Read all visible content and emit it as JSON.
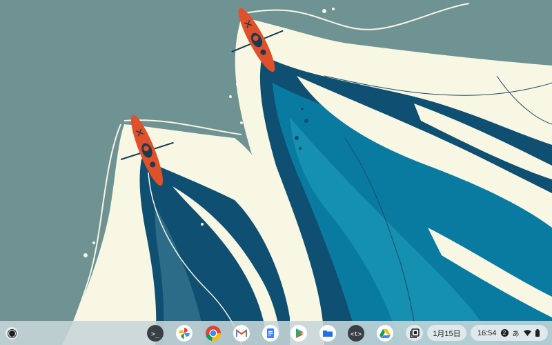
{
  "desktop": {
    "wallpaper": "kayak-river-illustration",
    "colors": {
      "background": "#6f9292",
      "cream": "#f7f7e4",
      "water_dark": "#0f4f72",
      "water_mid": "#0a7ba0",
      "water_light": "#1590b0",
      "kayak": "#e0502a"
    }
  },
  "shelf": {
    "launcher_icon": "launcher-circle-icon",
    "apps": [
      {
        "name": "Terminal",
        "icon": "terminal-icon",
        "glyph": ">_"
      },
      {
        "name": "Photos",
        "icon": "google-photos-icon"
      },
      {
        "name": "Chrome",
        "icon": "chrome-icon"
      },
      {
        "name": "Gmail",
        "icon": "gmail-icon"
      },
      {
        "name": "Docs",
        "icon": "google-docs-icon"
      },
      {
        "name": "Play Store",
        "icon": "play-store-icon"
      },
      {
        "name": "Files",
        "icon": "files-icon"
      },
      {
        "name": "Text",
        "icon": "text-editor-icon",
        "glyph": "<t>"
      },
      {
        "name": "Drive",
        "icon": "google-drive-icon"
      }
    ],
    "holding_space_icon": "holding-space-icon",
    "date": "1月15日",
    "time": "16:54",
    "notification_count": "2",
    "ime_indicator": "あ",
    "wifi_icon": "wifi-icon",
    "battery_icon": "battery-icon"
  }
}
